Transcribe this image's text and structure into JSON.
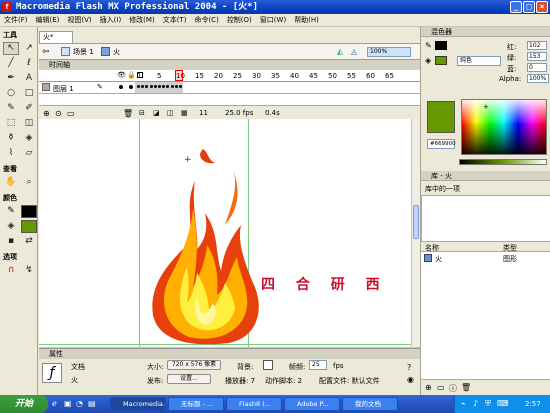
{
  "window": {
    "title": "Macromedia Flash MX Professional 2004 - [火*]",
    "app_icon": "f-logo-icon"
  },
  "menu": [
    "文件(F)",
    "编辑(E)",
    "视图(V)",
    "插入(I)",
    "修改(M)",
    "文本(T)",
    "命令(C)",
    "控制(O)",
    "窗口(W)",
    "帮助(H)"
  ],
  "toolbox": {
    "tools_label": "工具",
    "view_label": "查看",
    "colors_label": "颜色",
    "options_label": "选项"
  },
  "document": {
    "tab": "火*",
    "scene_label": "场景 1",
    "symbol_label": "火",
    "zoom": "100%",
    "timeline_label": "时间轴",
    "layer_name": "图层 1",
    "frame_numbers": [
      "1",
      "5",
      "10",
      "15",
      "20",
      "25",
      "30",
      "35",
      "40",
      "45",
      "50",
      "55",
      "60",
      "65"
    ],
    "current_frame": "11",
    "fps": "25.0 fps",
    "time": "0.4s",
    "stage_text": "四 合 研 西"
  },
  "properties": {
    "header": "属性",
    "type_label": "文档",
    "name": "火",
    "size_label": "大小:",
    "size_value": "720 x 576 像素",
    "bg_label": "背景:",
    "fps_label": "帧频:",
    "fps_value": "25",
    "fps_unit": "fps",
    "publish_label": "发布:",
    "settings_button": "设置...",
    "player_label": "播放器: 7",
    "script_label": "动作脚本: 2",
    "profile_label": "配置文件: 默认文件"
  },
  "color_mixer": {
    "header": "混色器",
    "fill_type": "纯色",
    "r_label": "红:",
    "r_value": "102",
    "g_label": "绿:",
    "g_value": "153",
    "b_label": "蓝:",
    "b_value": "0",
    "alpha_label": "Alpha:",
    "alpha_value": "100%",
    "hex": "#669900",
    "swatch_color": "#669900"
  },
  "library": {
    "header": "库 - 火",
    "count_label": "库中的一项",
    "col_name": "名称",
    "col_type": "类型",
    "item_name": "火",
    "item_type": "图形"
  },
  "taskbar": {
    "start": "开始",
    "tasks": [
      "Macromedia...",
      "无标题 - ...",
      "Flash8 (...",
      "Adobe P...",
      "我的文档"
    ],
    "clock": "2:57"
  }
}
